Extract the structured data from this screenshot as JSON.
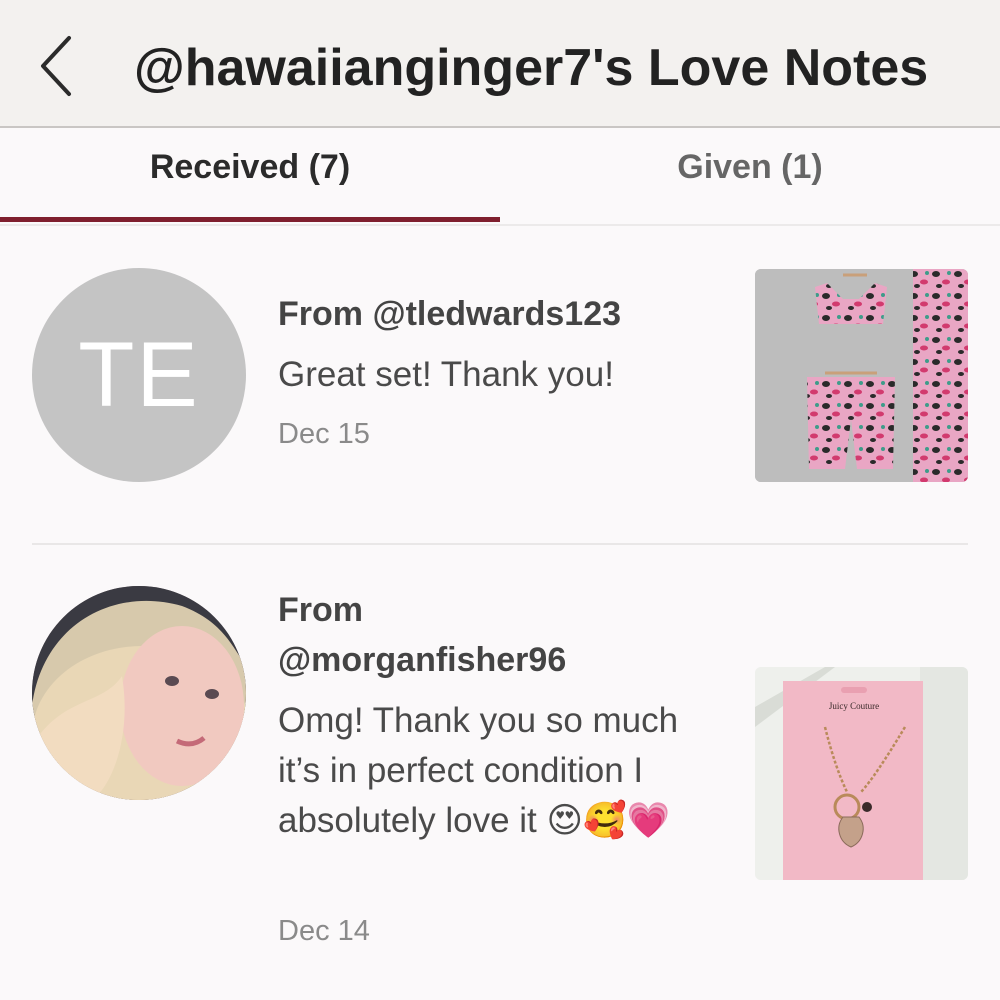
{
  "header": {
    "title": "@hawaiianginger7's Love Notes",
    "back_icon": "chevron-left-icon"
  },
  "tabs": [
    {
      "label": "Received (7)",
      "active": true
    },
    {
      "label": "Given (1)",
      "active": false
    }
  ],
  "colors": {
    "accent": "#7f1f2e",
    "header_bg": "#f3f1ef",
    "avatar_placeholder": "#c4c4c4"
  },
  "notes": [
    {
      "avatar_initials": "TE",
      "from": "From @tledwards123",
      "message": "Great set! Thank you!",
      "date": "Dec 15",
      "item_image": "pink-leopard-print-set"
    },
    {
      "avatar_initials": "",
      "from_line1": "From",
      "from_line2": "@morganfisher96",
      "message": "Omg! Thank you so much it’s in perfect condition I absolutely love it 😍🥰💗",
      "date": "Dec 14",
      "item_image": "juicy-couture-necklace",
      "item_brand": "Juicy Couture"
    }
  ]
}
